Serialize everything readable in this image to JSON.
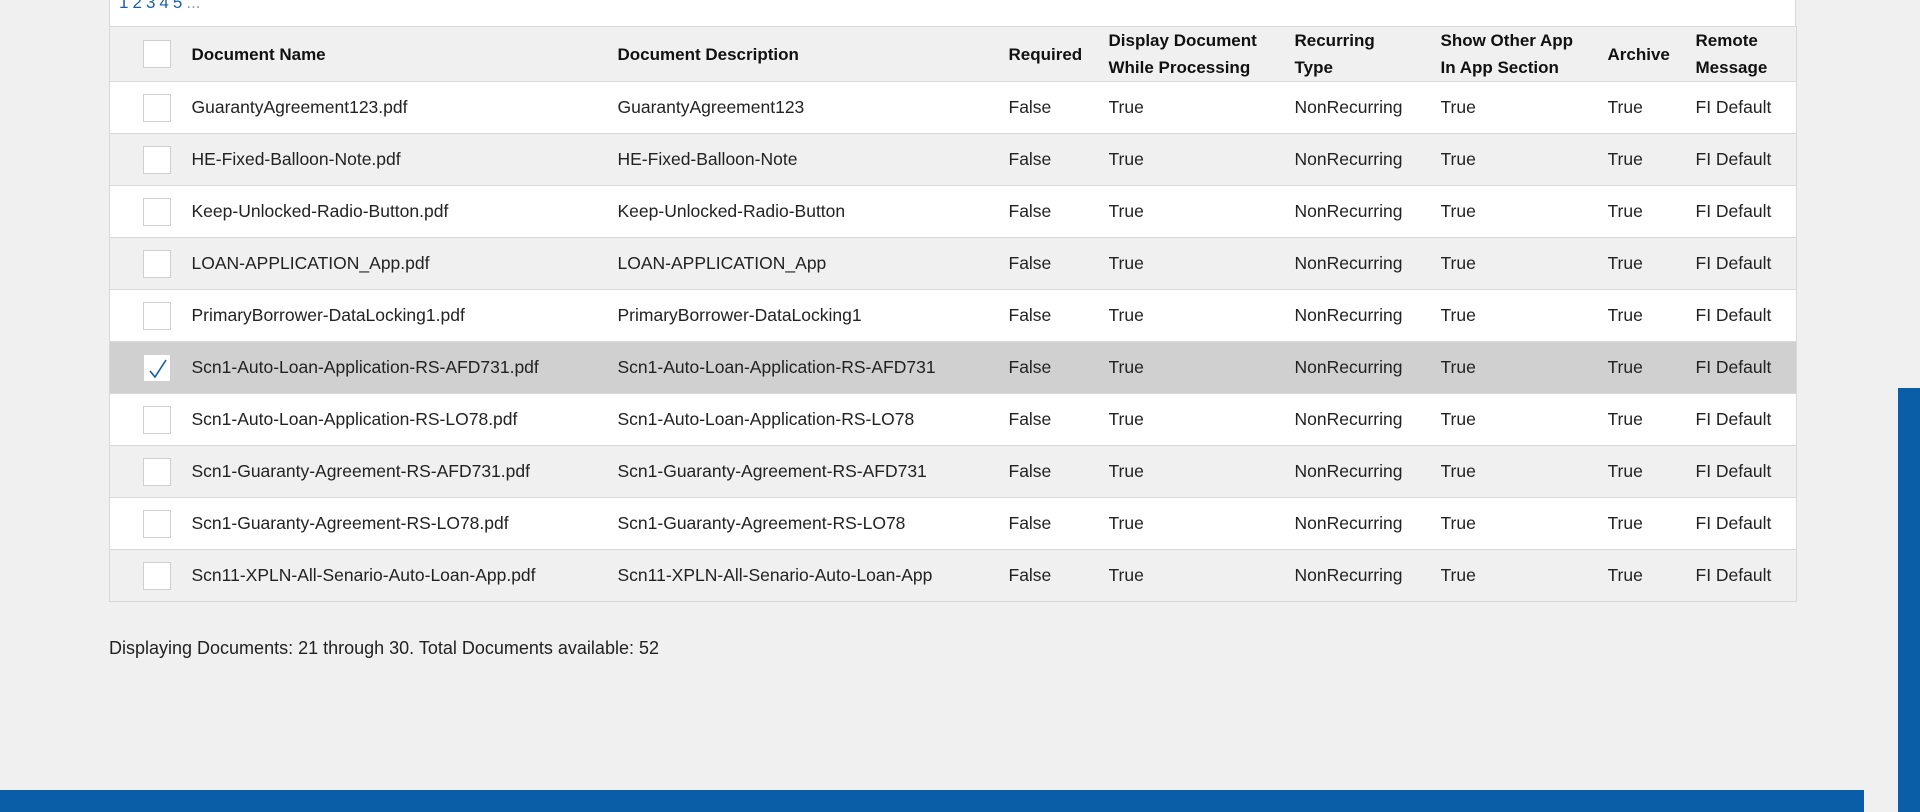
{
  "pager": {
    "pages": [
      "1",
      "2",
      "3",
      "4",
      "5"
    ],
    "ellipsis": "..."
  },
  "table": {
    "columns": {
      "name": "Document Name",
      "description": "Document Description",
      "required": "Required",
      "display_line1": "Display Document",
      "display_line2": "While Processing",
      "recurring_line1": "Recurring",
      "recurring_line2": "Type",
      "showother_line1": "Show Other App",
      "showother_line2": "In App Section",
      "archive": "Archive",
      "remote_line1": "Remote",
      "remote_line2": "Message"
    },
    "rows": [
      {
        "name": "GuarantyAgreement123.pdf",
        "description": "GuarantyAgreement123",
        "required": "False",
        "display": "True",
        "recurring": "NonRecurring",
        "show_other": "True",
        "archive": "True",
        "remote": "FI Default"
      },
      {
        "name": "HE-Fixed-Balloon-Note.pdf",
        "description": "HE-Fixed-Balloon-Note",
        "required": "False",
        "display": "True",
        "recurring": "NonRecurring",
        "show_other": "True",
        "archive": "True",
        "remote": "FI Default"
      },
      {
        "name": "Keep-Unlocked-Radio-Button.pdf",
        "description": "Keep-Unlocked-Radio-Button",
        "required": "False",
        "display": "True",
        "recurring": "NonRecurring",
        "show_other": "True",
        "archive": "True",
        "remote": "FI Default"
      },
      {
        "name": "LOAN-APPLICATION_App.pdf",
        "description": "LOAN-APPLICATION_App",
        "required": "False",
        "display": "True",
        "recurring": "NonRecurring",
        "show_other": "True",
        "archive": "True",
        "remote": "FI Default"
      },
      {
        "name": "PrimaryBorrower-DataLocking1.pdf",
        "description": "PrimaryBorrower-DataLocking1",
        "required": "False",
        "display": "True",
        "recurring": "NonRecurring",
        "show_other": "True",
        "archive": "True",
        "remote": "FI Default"
      },
      {
        "name": "Scn1-Auto-Loan-Application-RS-AFD731.pdf",
        "description": "Scn1-Auto-Loan-Application-RS-AFD731",
        "required": "False",
        "display": "True",
        "recurring": "NonRecurring",
        "show_other": "True",
        "archive": "True",
        "remote": "FI Default"
      },
      {
        "name": "Scn1-Auto-Loan-Application-RS-LO78.pdf",
        "description": "Scn1-Auto-Loan-Application-RS-LO78",
        "required": "False",
        "display": "True",
        "recurring": "NonRecurring",
        "show_other": "True",
        "archive": "True",
        "remote": "FI Default"
      },
      {
        "name": "Scn1-Guaranty-Agreement-RS-AFD731.pdf",
        "description": "Scn1-Guaranty-Agreement-RS-AFD731",
        "required": "False",
        "display": "True",
        "recurring": "NonRecurring",
        "show_other": "True",
        "archive": "True",
        "remote": "FI Default"
      },
      {
        "name": "Scn1-Guaranty-Agreement-RS-LO78.pdf",
        "description": "Scn1-Guaranty-Agreement-RS-LO78",
        "required": "False",
        "display": "True",
        "recurring": "NonRecurring",
        "show_other": "True",
        "archive": "True",
        "remote": "FI Default"
      },
      {
        "name": "Scn11-XPLN-All-Senario-Auto-Loan-App.pdf",
        "description": "Scn11-XPLN-All-Senario-Auto-Loan-App",
        "required": "False",
        "display": "True",
        "recurring": "NonRecurring",
        "show_other": "True",
        "archive": "True",
        "remote": "FI Default"
      }
    ]
  },
  "status": {
    "text": "Displaying Documents: 21 through 30. Total Documents available: 52"
  },
  "colors": {
    "accent_blue": "#0a5ea8",
    "selected_row": "#d0d0d0"
  },
  "icons": {
    "checkmark": "checkmark-icon"
  }
}
